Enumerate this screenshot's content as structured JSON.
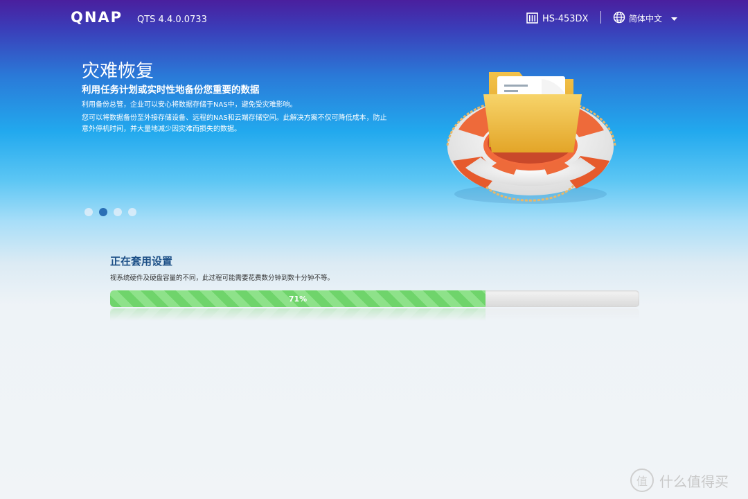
{
  "header": {
    "logo": "QNAP",
    "version": "QTS 4.4.0.0733",
    "model": "HS-453DX",
    "language": "简体中文"
  },
  "hero": {
    "title": "灾难恢复",
    "subtitle": "利用任务计划或实时性地备份您重要的数据",
    "paragraph1": "利用备份总管，企业可以安心将数据存储于NAS中，避免受灾难影响。",
    "paragraph2": "您可以将数据备份至外接存储设备、远程的NAS和云端存储空间。此解决方案不仅可降低成本，防止意外停机时间，并大量地减少因灾难而损失的数据。"
  },
  "carousel": {
    "count": 4,
    "active_index": 1
  },
  "status": {
    "title": "正在套用设置",
    "description": "视系统硬件及硬盘容量的不同，此过程可能需要花费数分钟到数十分钟不等。",
    "progress_text": "71%",
    "progress_fraction": 0.71
  },
  "watermark": {
    "text": "什么值得买",
    "symbol": "值"
  },
  "colors": {
    "progress_green": "#6fd46b",
    "active_dot": "#2a6fb5",
    "status_title": "#1c4f86"
  }
}
